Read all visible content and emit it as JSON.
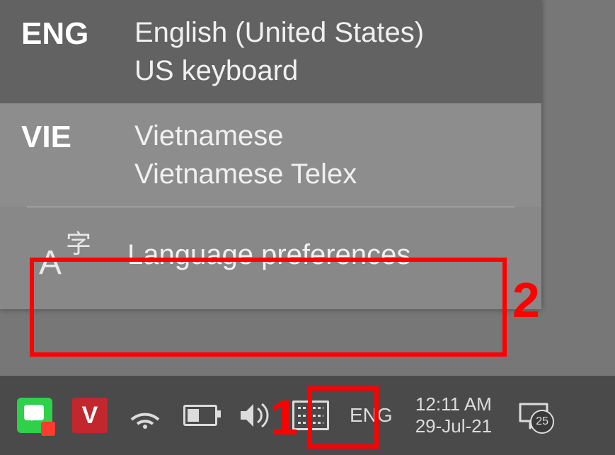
{
  "popup": {
    "items": [
      {
        "code": "ENG",
        "name": "English (United States)",
        "keyboard": "US keyboard",
        "selected": true
      },
      {
        "code": "VIE",
        "name": "Vietnamese",
        "keyboard": "Vietnamese Telex",
        "selected": false
      }
    ],
    "prefs_label": "Language preferences"
  },
  "taskbar": {
    "v_label": "V",
    "language_indicator": "ENG",
    "clock_time": "12:11 AM",
    "clock_date": "29-Jul-21",
    "notif_count": "25"
  },
  "annotations": {
    "one": "1",
    "two": "2"
  }
}
